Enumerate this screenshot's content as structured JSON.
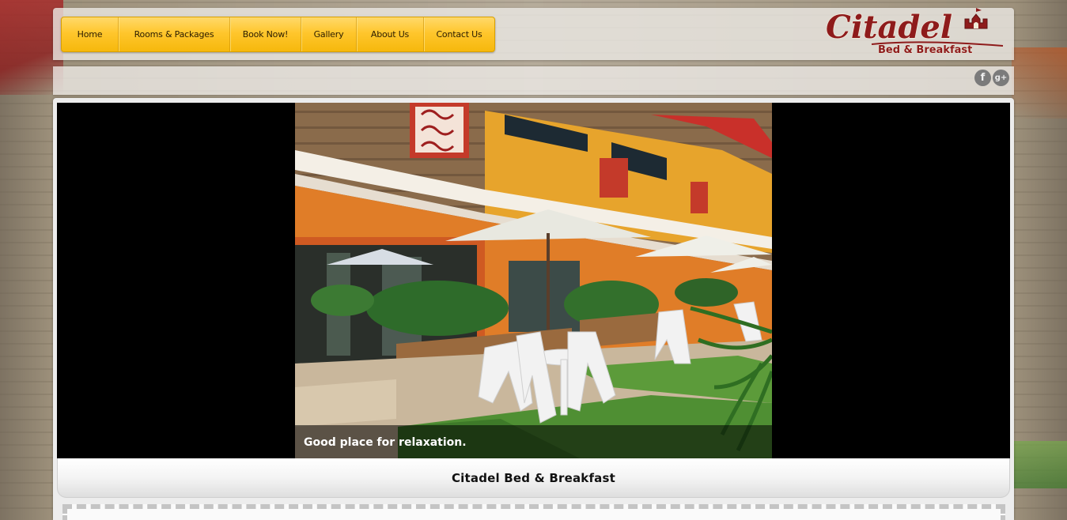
{
  "nav": {
    "items": [
      {
        "label": "Home"
      },
      {
        "label": "Rooms & Packages"
      },
      {
        "label": "Book Now!"
      },
      {
        "label": "Gallery"
      },
      {
        "label": "About Us"
      },
      {
        "label": "Contact Us"
      }
    ]
  },
  "logo": {
    "name": "Citadel",
    "tagline": "Bed & Breakfast"
  },
  "social": [
    {
      "icon": "facebook-icon",
      "glyph": "f"
    },
    {
      "icon": "google-plus-icon",
      "glyph": "g+"
    }
  ],
  "slider": {
    "caption": "Good place for relaxation."
  },
  "site_title": "Citadel Bed & Breakfast",
  "colors": {
    "nav_yellow": "#ffc62d",
    "logo_red": "#8e1b1b",
    "logo_green": "#1f5a2a"
  }
}
